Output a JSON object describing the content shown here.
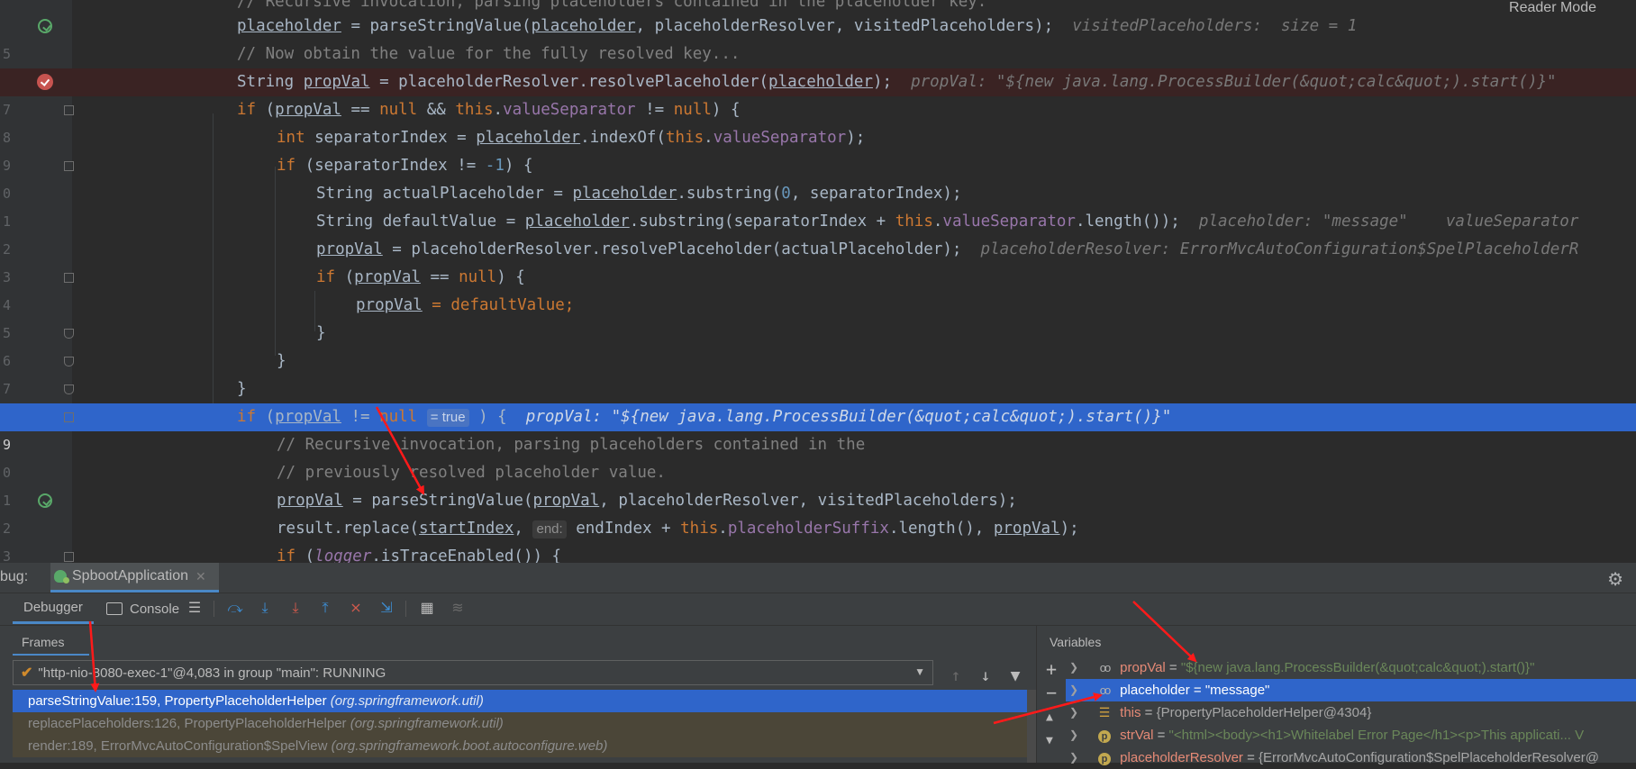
{
  "editor": {
    "reader_mode": "Reader Mode",
    "lines": [
      {
        "num": "",
        "icon": "none",
        "style": "normal"
      },
      {
        "num": "5",
        "icon": "restart",
        "style": "normal"
      },
      {
        "num": "",
        "icon": "none",
        "style": "normal"
      },
      {
        "num": "7",
        "icon": "breakpoint",
        "style": "bp"
      },
      {
        "num": "8",
        "icon": "fold",
        "style": "normal"
      },
      {
        "num": "9",
        "icon": "none",
        "style": "normal"
      },
      {
        "num": "0",
        "icon": "fold",
        "style": "normal"
      },
      {
        "num": "1",
        "icon": "none",
        "style": "normal"
      },
      {
        "num": "2",
        "icon": "none",
        "style": "normal"
      },
      {
        "num": "3",
        "icon": "none",
        "style": "normal"
      },
      {
        "num": "4",
        "icon": "fold",
        "style": "normal"
      },
      {
        "num": "5",
        "icon": "none",
        "style": "normal"
      },
      {
        "num": "6",
        "icon": "fold-up",
        "style": "normal"
      },
      {
        "num": "7",
        "icon": "fold-up",
        "style": "normal"
      },
      {
        "num": "8",
        "icon": "fold-up",
        "style": "normal"
      },
      {
        "num": "9",
        "icon": "fold",
        "style": "cur"
      },
      {
        "num": "0",
        "icon": "none",
        "style": "normal"
      },
      {
        "num": "1",
        "icon": "none",
        "style": "normal"
      },
      {
        "num": "2",
        "icon": "restart",
        "style": "normal"
      },
      {
        "num": "3",
        "icon": "none",
        "style": "normal"
      },
      {
        "num": "4",
        "icon": "fold",
        "style": "normal"
      }
    ],
    "code": {
      "l0_comment": "// Recursive invocation, parsing placeholders contained in the placeholder key.",
      "l1_a": "placeholder",
      "l1_b": " = parseStringValue(",
      "l1_c": "placeholder",
      "l1_d": ", placeholderResolver, visitedPlaceholders);",
      "l1_inline": "visitedPlaceholders:  size = 1",
      "l2_comment": "// Now obtain the value for the fully resolved key...",
      "l3_a": "String ",
      "l3_b": "propVal",
      "l3_c": " = placeholderResolver.resolvePlaceholder(",
      "l3_d": "placeholder",
      "l3_e": ");",
      "l3_inline": "propVal: \"${new java.lang.ProcessBuilder(&quot;calc&quot;).start()}\"",
      "l4_kw_if": "if",
      "l4_a": " (",
      "l4_b": "propVal",
      "l4_c": " == ",
      "l4_null": "null",
      "l4_d": " && ",
      "l4_this": "this",
      "l4_e": ".",
      "l4_f": "valueSeparator",
      "l4_g": " != ",
      "l4_h": ") {",
      "l5_kw": "int",
      "l5_a": " separatorIndex = ",
      "l5_b": "placeholder",
      "l5_c": ".indexOf(",
      "l5_this": "this",
      "l5_d": ".",
      "l5_e": "valueSeparator",
      "l5_f": ");",
      "l6_kw": "if",
      "l6_a": " (separatorIndex != ",
      "l6_num": "-1",
      "l6_b": ") {",
      "l7_a": "String actualPlaceholder = ",
      "l7_b": "placeholder",
      "l7_c": ".substring(",
      "l7_num": "0",
      "l7_d": ", separatorIndex);",
      "l8_a": "String defaultValue = ",
      "l8_b": "placeholder",
      "l8_c": ".substring(separatorIndex + ",
      "l8_this": "this",
      "l8_d": ".",
      "l8_e": "valueSeparator",
      "l8_f": ".length());",
      "l8_inline": "placeholder: \"message\"    valueSeparator",
      "l9_a": "propVal",
      "l9_b": " = placeholderResolver.resolvePlaceholder(actualPlaceholder);",
      "l9_inline": "placeholderResolver: ErrorMvcAutoConfiguration$SpelPlaceholderR",
      "l10_kw": "if",
      "l10_a": " (",
      "l10_b": "propVal",
      "l10_c": " == ",
      "l10_null": "null",
      "l10_d": ") {",
      "l11_a": "propVal",
      "l11_b": " = defaultValue;",
      "brace": "}",
      "l15_kw": "if",
      "l15_a": " (",
      "l15_b": "propVal",
      "l15_c": " != ",
      "l15_null": "null",
      "l15_hint": "= true",
      "l15_d": ") {",
      "l15_inline": "propVal: \"${new java.lang.ProcessBuilder(&quot;calc&quot;).start()}\"",
      "l16_comment": "// Recursive invocation, parsing placeholders contained in the",
      "l17_comment": "// previously resolved placeholder value.",
      "l18_a": "propVal",
      "l18_b": " = parseStringValue(",
      "l18_c": "propVal",
      "l18_d": ", placeholderResolver, visitedPlaceholders);",
      "l19_a": "result.replace(",
      "l19_b": "startIndex",
      "l19_c": ", ",
      "l19_hint": "end:",
      "l19_d": " endIndex + ",
      "l19_this": "this",
      "l19_e": ".",
      "l19_f": "placeholderSuffix",
      "l19_g": ".length(), ",
      "l19_h": "propVal",
      "l19_i": ");",
      "l20_kw": "if",
      "l20_a": " (",
      "l20_b": "logger",
      "l20_c": ".isTraceEnabled()) {"
    }
  },
  "debug": {
    "label": "bug:",
    "session_tab": "SpbootApplication",
    "close_glyph": "✕",
    "gear_glyph": "⚙",
    "toolbar": {
      "debugger_tab": "Debugger",
      "console_tab": "Console"
    },
    "frames": {
      "title": "Frames",
      "thread": "\"http-nio-8080-exec-1\"@4,083 in group \"main\": RUNNING",
      "items": [
        {
          "method": "parseStringValue:159, PropertyPlaceholderHelper",
          "pkg": "(org.springframework.util)"
        },
        {
          "method": "replacePlaceholders:126, PropertyPlaceholderHelper",
          "pkg": "(org.springframework.util)"
        },
        {
          "method": "render:189, ErrorMvcAutoConfiguration$SpelView",
          "pkg": "(org.springframework.boot.autoconfigure.web)"
        }
      ]
    },
    "variables": {
      "title": "Variables",
      "items": [
        {
          "name": "propVal",
          "eq": " = ",
          "value": "\"${new java.lang.ProcessBuilder(&quot;calc&quot;).start()}\""
        },
        {
          "name": "placeholder",
          "eq": " = ",
          "value": "\"message\""
        },
        {
          "name": "this",
          "eq": " = ",
          "value": "{PropertyPlaceholderHelper@4304}"
        },
        {
          "name": "strVal",
          "eq": " = ",
          "value": "\"<html><body><h1>Whitelabel Error Page</h1><p>This applicati... V"
        },
        {
          "name": "placeholderResolver",
          "eq": " = ",
          "value": "{ErrorMvcAutoConfiguration$SpelPlaceholderResolver@"
        }
      ]
    }
  }
}
